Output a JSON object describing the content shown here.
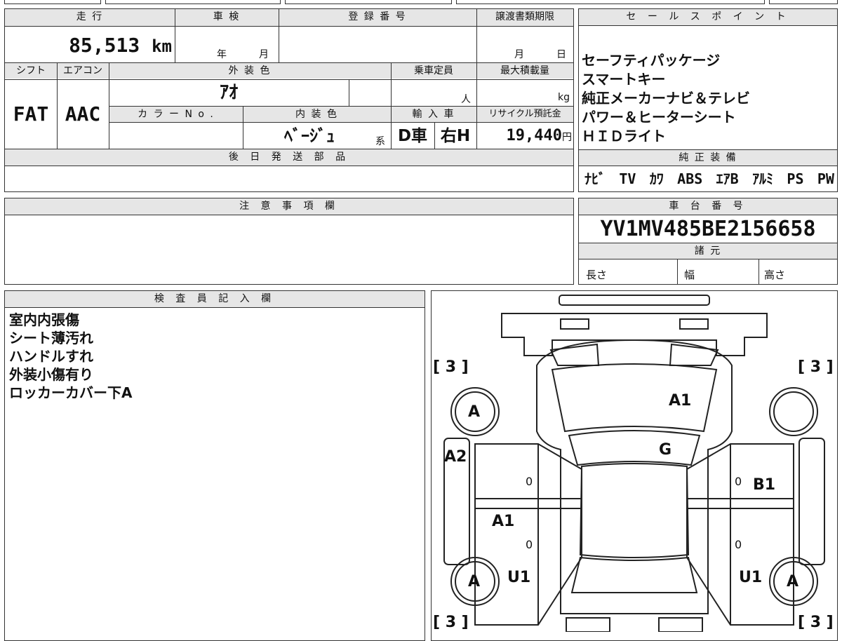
{
  "vehicle": {
    "headers": {
      "mileage": "走 行",
      "inspection": "車 検",
      "registration": "登 録 番 号",
      "transfer_deadline": "譲渡書類期限",
      "shift": "シフト",
      "aircon": "エアコン",
      "exterior_color": "外 装 色",
      "capacity": "乗車定員",
      "max_load": "最大積載量",
      "color_no": "カ ラ ー N o .",
      "interior_color": "内 装 色",
      "import": "輸 入 車",
      "recycle": "リサイクル預託金",
      "later_parts": "後 日 発 送 部 品",
      "caution": "注 意 事 項 欄",
      "inspector": "検 査 員 記 入 欄"
    },
    "mileage": "85,513",
    "mileage_unit": "km",
    "inspection_year_unit": "年",
    "inspection_month_unit": "月",
    "deadline_month_unit": "月",
    "deadline_day_unit": "日",
    "shift": "FAT",
    "aircon": "AAC",
    "exterior_color": "ｱｵ",
    "capacity_unit": "人",
    "max_load_unit": "kg",
    "interior_color": "ﾍﾞｰｼﾞｭ",
    "interior_suffix": "系",
    "import_type": "D車",
    "steering": "右H",
    "recycle_fee": "19,440",
    "recycle_unit": "円"
  },
  "sales_points": {
    "header": "セ ー ル ス ポ イ ン ト",
    "items": [
      "セーフティパッケージ",
      "スマートキー",
      "純正メーカーナビ＆テレビ",
      "パワー＆ヒーターシート",
      "ＨＩＤライト"
    ]
  },
  "genuine_equipment": {
    "header": "純 正 装 備",
    "items": [
      "ﾅﾋﾞ",
      "TV",
      "ｶﾜ",
      "ABS",
      "ｴｱB",
      "ｱﾙﾐ",
      "PS",
      "PW"
    ]
  },
  "chassis": {
    "header": "車 台 番 号",
    "number": "YV1MV485BE2156658",
    "spec_header": "諸 元",
    "length": "長さ",
    "width": "幅",
    "height": "高さ"
  },
  "inspector_notes": [
    "室内内張傷",
    "シート薄汚れ",
    "ハンドルすれ",
    "外装小傷有り",
    "ロッカーカバー下A"
  ],
  "diagram": {
    "tire_left_top": "[ 3 ]",
    "tire_right_top": "[ 3 ]",
    "tire_left_bottom": "[ 3 ]",
    "tire_right_bottom": "[ 3 ]",
    "wheel_fl": "A",
    "wheel_fr": "",
    "wheel_rl": "A",
    "wheel_rr": "A",
    "hood": "A1",
    "windshield": "G",
    "left_fender": "A2",
    "right_front_door": "B1",
    "left_rear_door": "A1",
    "left_rocker": "U1",
    "right_rocker": "U1",
    "door_zero_1": "0",
    "door_zero_2": "0",
    "door_zero_3": "0",
    "door_zero_4": "0"
  },
  "colors": {
    "header_bg": "#e6e6e6",
    "line": "#333333"
  }
}
